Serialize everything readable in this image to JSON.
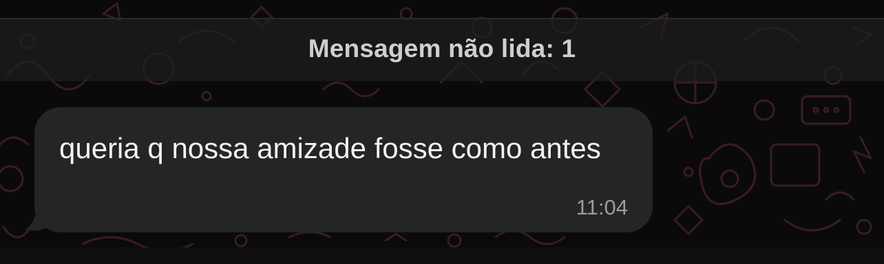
{
  "unread_divider": {
    "label": "Mensagem não lida: 1"
  },
  "message": {
    "text": "queria q nossa amizade fosse como antes",
    "time": "11:04"
  },
  "colors": {
    "background": "#0b0a0b",
    "bubble": "#242626",
    "wallpaper_doodles": "#3a1c24"
  }
}
